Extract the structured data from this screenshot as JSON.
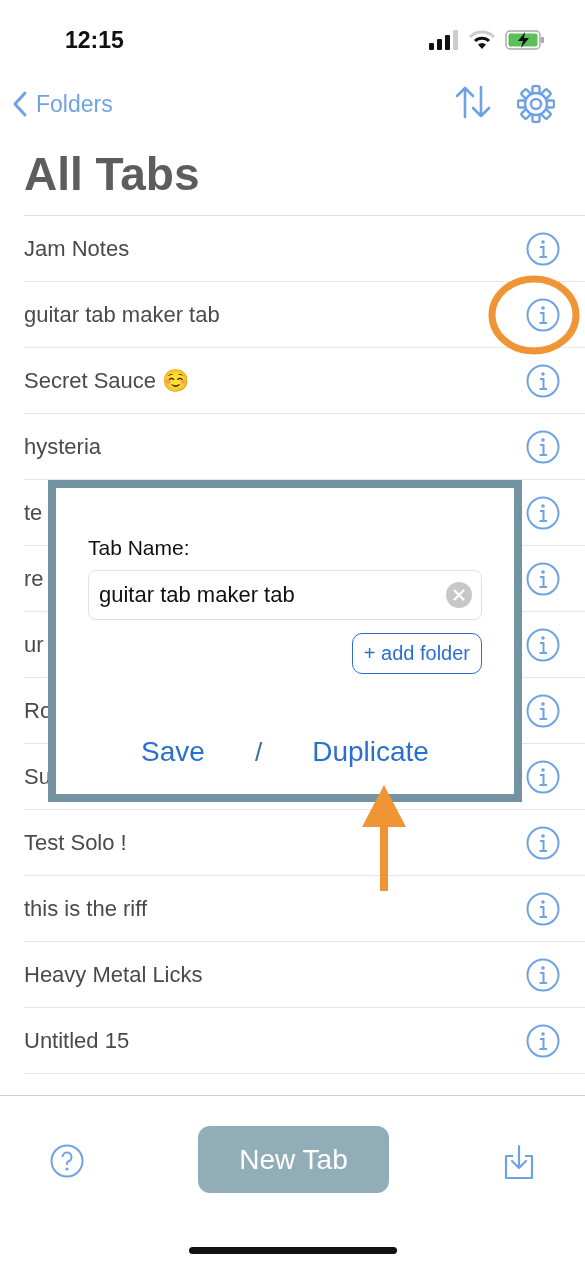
{
  "status_bar": {
    "time": "12:15"
  },
  "nav": {
    "back_label": "Folders"
  },
  "title": "All Tabs",
  "tabs": [
    {
      "name": "Jam Notes",
      "circled": false
    },
    {
      "name": "guitar tab maker tab",
      "circled": true
    },
    {
      "name": "Secret Sauce ☺️",
      "circled": false
    },
    {
      "name": "hysteria",
      "circled": false
    },
    {
      "name": "te",
      "circled": false
    },
    {
      "name": "re",
      "circled": false
    },
    {
      "name": "ur",
      "circled": false
    },
    {
      "name": "Ro",
      "circled": false
    },
    {
      "name": "Su",
      "circled": false
    },
    {
      "name": "Test Solo !",
      "circled": false
    },
    {
      "name": "this is the riff",
      "circled": false
    },
    {
      "name": "Heavy Metal Licks",
      "circled": false
    },
    {
      "name": "Untitled 15",
      "circled": false
    }
  ],
  "dialog": {
    "label": "Tab Name:",
    "value": "guitar tab maker tab",
    "add_folder": "+ add folder",
    "save": "Save",
    "separator": "/",
    "duplicate": "Duplicate",
    "arrow_to_duplicate": true
  },
  "bottom_bar": {
    "new_tab": "New Tab"
  }
}
